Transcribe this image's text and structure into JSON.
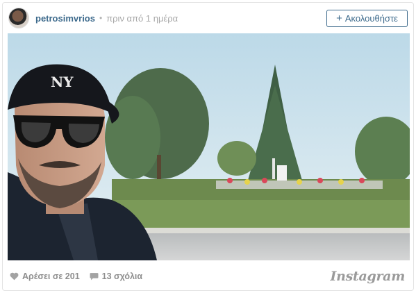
{
  "post": {
    "username": "petrosimvrios",
    "separator": "•",
    "time_ago": "πριν από 1 ημέρα",
    "follow_label": "Ακολουθήστε",
    "follow_plus": "+"
  },
  "footer": {
    "likes_label": "Αρέσει σε 201",
    "comments_label": "13 σχόλια",
    "brand": "Instagram"
  },
  "icons": {
    "avatar": "profile-photo",
    "like": "heart-icon",
    "comment": "speech-bubble-icon",
    "follow": "plus-icon"
  },
  "colors": {
    "link": "#3d6a8c",
    "muted": "#a8a8a8",
    "footer_text": "#8e8e8e"
  }
}
